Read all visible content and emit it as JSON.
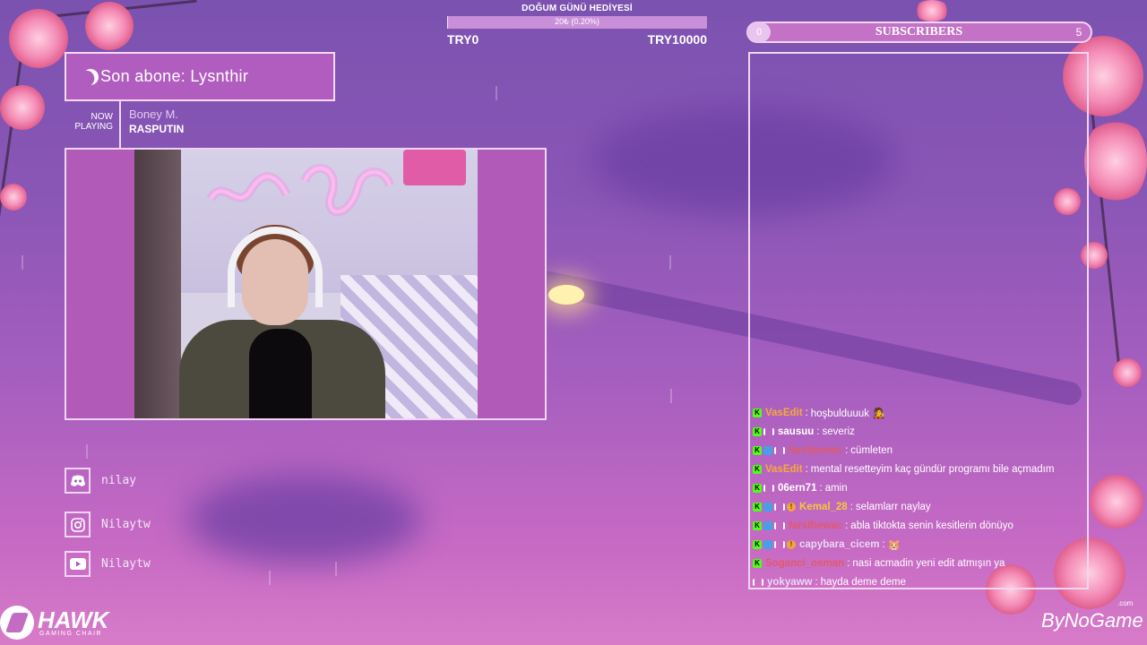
{
  "donation": {
    "title": "DOĞUM GÜNÜ HEDİYESİ",
    "progress_text": "20₺ (0.20%)",
    "progress_fraction": 0.002,
    "min_label": "TRY0",
    "max_label": "TRY10000"
  },
  "last_sub": {
    "text": "Son abone: Lysnthir"
  },
  "now_playing": {
    "label_line1": "NOW",
    "label_line2": "PLAYING",
    "artist": "Boney M.",
    "song": "RASPUTIN"
  },
  "socials": [
    {
      "icon": "discord-icon",
      "handle": "nilay"
    },
    {
      "icon": "instagram-icon",
      "handle": "Nilaytw"
    },
    {
      "icon": "youtube-icon",
      "handle": "Nilaytw"
    }
  ],
  "subscribers": {
    "current": "0",
    "title": "SUBSCRIBERS",
    "goal": "5"
  },
  "chat": {
    "messages": [
      {
        "badges": [
          "k"
        ],
        "user": "VasEdit",
        "color": "#f6a93b",
        "text": "hoşbulduuuk 🧑‍🎤"
      },
      {
        "badges": [
          "k",
          "bars"
        ],
        "user": "sausuu",
        "color": "#ffffff",
        "text": "severiz"
      },
      {
        "badges": [
          "k",
          "sub",
          "bars"
        ],
        "user": "farsthewac",
        "color": "#e05a6a",
        "text": "cümleten"
      },
      {
        "badges": [
          "k"
        ],
        "user": "VasEdit",
        "color": "#f6a93b",
        "text": "mental resetteyim kaç gündür programı bile açmadım"
      },
      {
        "badges": [
          "k",
          "bars"
        ],
        "user": "06ern71",
        "color": "#ffffff",
        "text": "amin"
      },
      {
        "badges": [
          "k",
          "sub",
          "bars",
          "gift"
        ],
        "user": "Kemal_28",
        "color": "#f6c83b",
        "text": "selamlarr naylay"
      },
      {
        "badges": [
          "k",
          "sub",
          "bars"
        ],
        "user": "farsthewac",
        "color": "#e05a6a",
        "text": "abla tiktokta senin kesitlerin dönüyo"
      },
      {
        "badges": [
          "k",
          "sub",
          "bars",
          "gift"
        ],
        "user": "capybara_cicem",
        "color": "#e9d9f2",
        "text": "🐹"
      },
      {
        "badges": [
          "k"
        ],
        "user": "Soganci_osman",
        "color": "#e05a6a",
        "text": "nasi acmadin yeni edit atmışın ya"
      },
      {
        "badges": [
          "bars"
        ],
        "user": "yokyaww",
        "color": "#e9d9f2",
        "text": "hayda deme deme"
      }
    ]
  },
  "sponsor": {
    "name": "HAWK",
    "tagline": "GAMING CHAIR"
  },
  "watermark": {
    "text": "ByNoGame",
    "suffix": ".com"
  }
}
